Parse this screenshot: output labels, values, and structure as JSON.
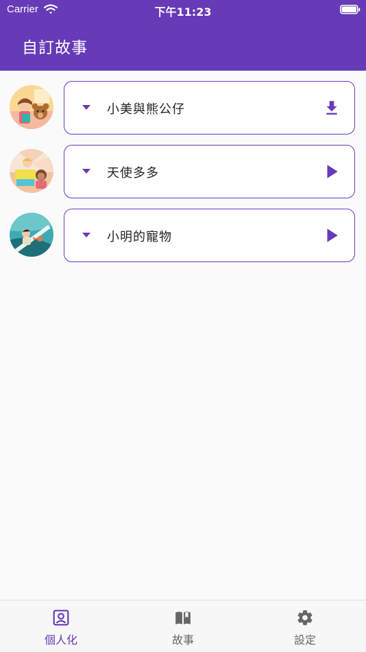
{
  "status_bar": {
    "carrier": "Carrier",
    "time": "下午11:23"
  },
  "app_bar": {
    "title": "自訂故事"
  },
  "stories": [
    {
      "title": "小美與熊公仔",
      "action": "download-icon"
    },
    {
      "title": "天使多多",
      "action": "play-icon"
    },
    {
      "title": "小明的寵物",
      "action": "play-icon"
    }
  ],
  "bottom_nav": {
    "items": [
      {
        "label": "個人化",
        "icon": "profile-icon",
        "active": true
      },
      {
        "label": "故事",
        "icon": "book-icon",
        "active": false
      },
      {
        "label": "設定",
        "icon": "gear-icon",
        "active": false
      }
    ]
  },
  "colors": {
    "primary": "#673ab7",
    "background": "#fafafa",
    "text": "#222222",
    "nav_inactive": "#666666"
  }
}
